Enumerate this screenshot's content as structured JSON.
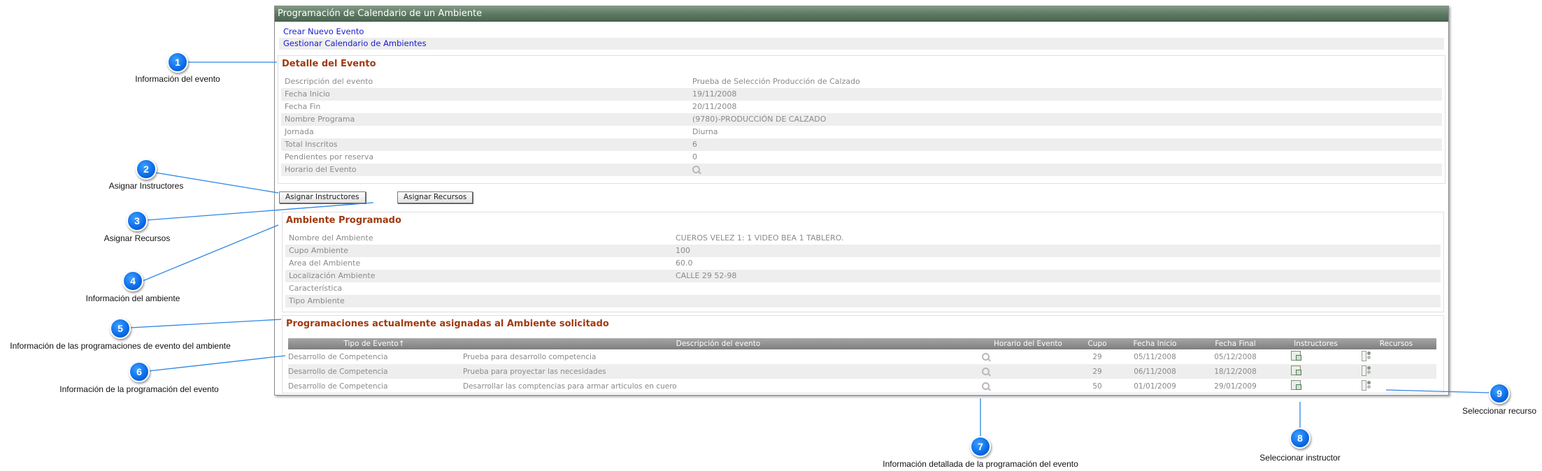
{
  "window": {
    "title": "Programación de Calendario de un Ambiente"
  },
  "links": [
    "Crear Nuevo Evento",
    "Gestionar Calendario de Ambientes"
  ],
  "event_detail": {
    "title": "Detalle del Evento",
    "rows": [
      {
        "label": "Descripción del evento",
        "value": "Prueba de Selección Producción de Calzado"
      },
      {
        "label": "Fecha Inicio",
        "value": "19/11/2008"
      },
      {
        "label": "Fecha Fin",
        "value": "20/11/2008"
      },
      {
        "label": "Nombre Programa",
        "value": "(9780)-PRODUCCIÓN DE CALZADO"
      },
      {
        "label": "Jornada",
        "value": "Diurna"
      },
      {
        "label": "Total Inscritos",
        "value": "6"
      },
      {
        "label": "Pendientes por reserva",
        "value": "0"
      },
      {
        "label": "Horario del Evento",
        "value": ""
      }
    ]
  },
  "buttons": {
    "assign_instructors": "Asignar Instructores",
    "assign_resources": "Asignar Recursos"
  },
  "environment": {
    "title": "Ambiente Programado",
    "rows": [
      {
        "label": "Nombre del Ambiente",
        "value": "CUEROS VELEZ 1: 1 VIDEO BEA 1 TABLERO."
      },
      {
        "label": "Cupo Ambiente",
        "value": "100"
      },
      {
        "label": "Area del Ambiente",
        "value": "60.0"
      },
      {
        "label": "Localización Ambiente",
        "value": "CALLE 29 52-98"
      },
      {
        "label": "Característica",
        "value": ""
      },
      {
        "label": "Tipo Ambiente",
        "value": ""
      }
    ]
  },
  "schedules": {
    "title": "Programaciones actualmente asignadas al Ambiente solicitado",
    "columns": [
      "Tipo de Evento↑",
      "Descripción del evento",
      "Horario del Evento",
      "Cupo",
      "Fecha Inicio",
      "Fecha Final",
      "Instructores",
      "Recursos"
    ],
    "rows": [
      {
        "tipo": "Desarrollo de Competencia",
        "descripcion": "Prueba para desarrollo competencia",
        "cupo": "29",
        "inicio": "05/11/2008",
        "final": "05/12/2008"
      },
      {
        "tipo": "Desarrollo de Competencia",
        "descripcion": "Prueba para proyectar las necesidades",
        "cupo": "29",
        "inicio": "06/11/2008",
        "final": "18/12/2008"
      },
      {
        "tipo": "Desarrollo de Competencia",
        "descripcion": "Desarrollar las comptencias para armar articulos en cuero",
        "cupo": "50",
        "inicio": "01/01/2009",
        "final": "29/01/2009"
      }
    ]
  },
  "callouts": [
    {
      "number": "1",
      "label": "Información del evento"
    },
    {
      "number": "2",
      "label": "Asignar Instructores"
    },
    {
      "number": "3",
      "label": "Asignar Recursos"
    },
    {
      "number": "4",
      "label": "Información del ambiente"
    },
    {
      "number": "5",
      "label": "Información de las programaciones de evento del ambiente"
    },
    {
      "number": "6",
      "label": "Información de la programación del evento"
    },
    {
      "number": "7",
      "label": "Información detallada de la programación del evento"
    },
    {
      "number": "8",
      "label": "Seleccionar instructor"
    },
    {
      "number": "9",
      "label": "Seleccionar recurso"
    }
  ],
  "colors": {
    "callout_blue": "#0a6ae6",
    "connector": "#2e86e6",
    "title_green": "#5d7762",
    "section_red": "#a03a10",
    "link_blue": "#1a1acc"
  }
}
